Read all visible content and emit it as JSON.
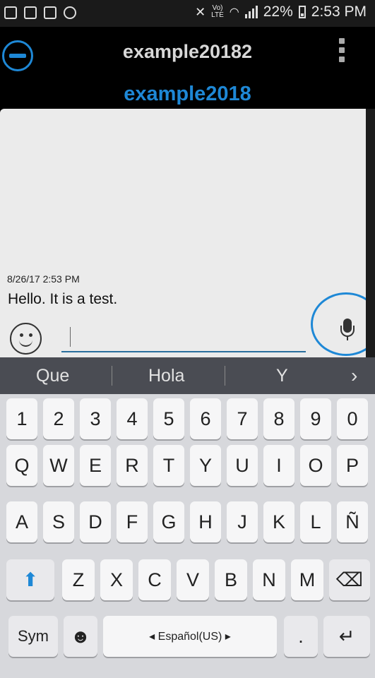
{
  "status_bar": {
    "lte_top": "Vo)",
    "lte_bottom": "LTE",
    "battery_percent": "22%",
    "time": "2:53 PM"
  },
  "header": {
    "title": "example20182",
    "contact": "example2018"
  },
  "chat": {
    "messages": [
      {
        "timestamp": "8/26/17 2:53 PM",
        "text": "Hello. It is a test."
      }
    ],
    "input_value": ""
  },
  "suggestions": {
    "items": [
      "Que",
      "Hola",
      "Y"
    ],
    "more_glyph": "›"
  },
  "keyboard": {
    "number_row": [
      "1",
      "2",
      "3",
      "4",
      "5",
      "6",
      "7",
      "8",
      "9",
      "0"
    ],
    "row1": [
      "Q",
      "W",
      "E",
      "R",
      "T",
      "Y",
      "U",
      "I",
      "O",
      "P"
    ],
    "row2": [
      "A",
      "S",
      "D",
      "F",
      "G",
      "H",
      "J",
      "K",
      "L",
      "Ñ"
    ],
    "row3": [
      "Z",
      "X",
      "C",
      "V",
      "B",
      "N",
      "M"
    ],
    "sym_label": "Sym",
    "space_label": "◂ Español(US) ▸",
    "period_label": ".",
    "shift_glyph": "⬆",
    "backspace_glyph": "⌫",
    "enter_glyph": "↵",
    "emoji_glyph": "☻"
  },
  "colors": {
    "accent": "#1e88d6",
    "chat_background": "#ebebeb",
    "keyboard_background": "#d7d8dc"
  }
}
